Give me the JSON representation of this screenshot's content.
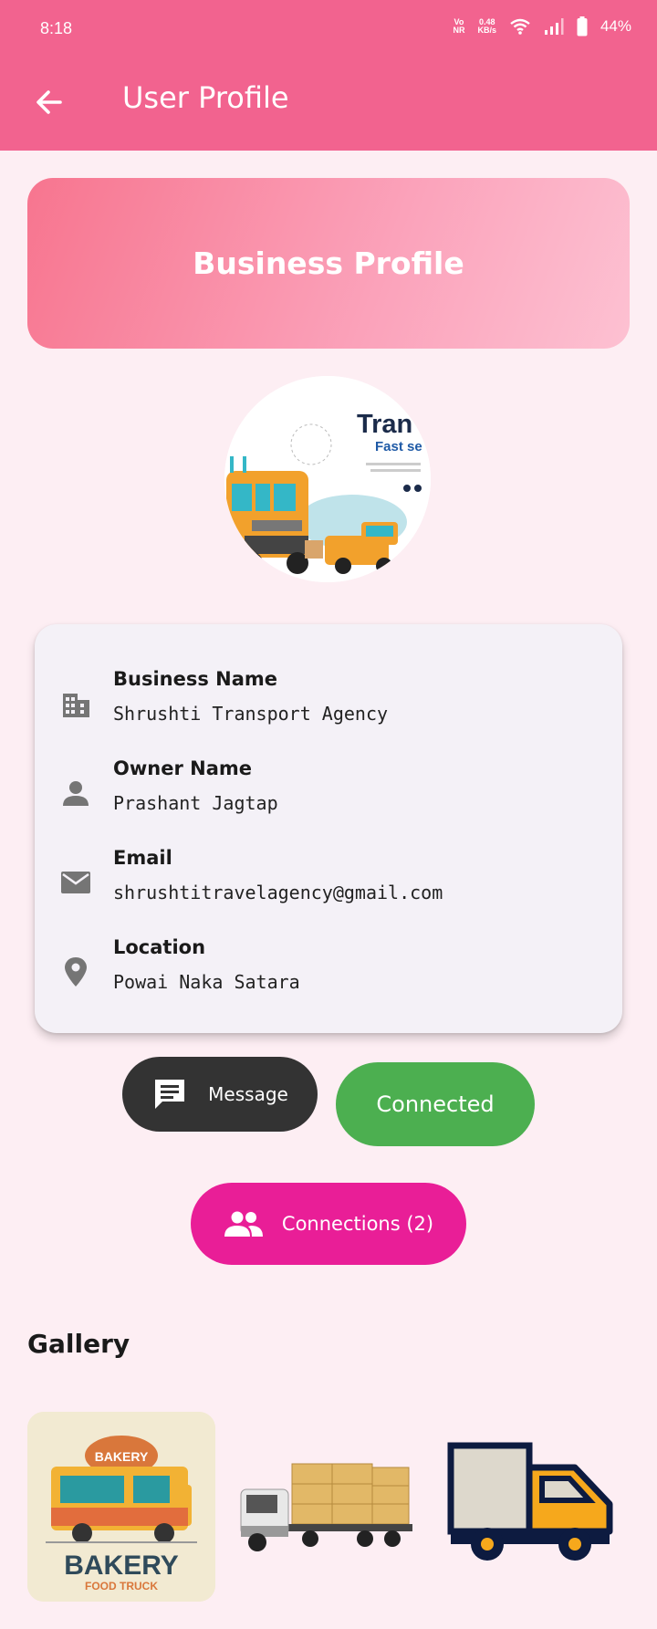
{
  "status_bar": {
    "time": "8:18",
    "network_top": "Vo",
    "network_bottom": "NR",
    "speed_top": "0.48",
    "speed_bottom": "KB/s",
    "battery": "44%"
  },
  "appbar": {
    "title": "User Profile"
  },
  "banner": {
    "title": "Business Profile"
  },
  "avatar": {
    "logo_text_1": "Tran",
    "logo_text_2": "Fast se"
  },
  "details": [
    {
      "label": "Business Name",
      "value": "Shrushti Transport Agency",
      "icon": "building-icon"
    },
    {
      "label": "Owner Name",
      "value": "Prashant Jagtap",
      "icon": "person-icon"
    },
    {
      "label": "Email",
      "value": "shrushtitravelagency@gmail.com",
      "icon": "email-icon"
    },
    {
      "label": "Location",
      "value": "Powai Naka Satara",
      "icon": "location-pin-icon"
    }
  ],
  "actions": {
    "message": "Message",
    "connected": "Connected",
    "connections": "Connections (2)"
  },
  "gallery": {
    "title": "Gallery",
    "bakery_sign": "BAKERY",
    "bakery_text": "BAKERY",
    "bakery_sub": "FOOD TRUCK"
  },
  "colors": {
    "appbar": "#f2638f",
    "background": "#fdeef3",
    "connected": "#4caf50",
    "connections": "#e91e97",
    "message": "#333333"
  }
}
